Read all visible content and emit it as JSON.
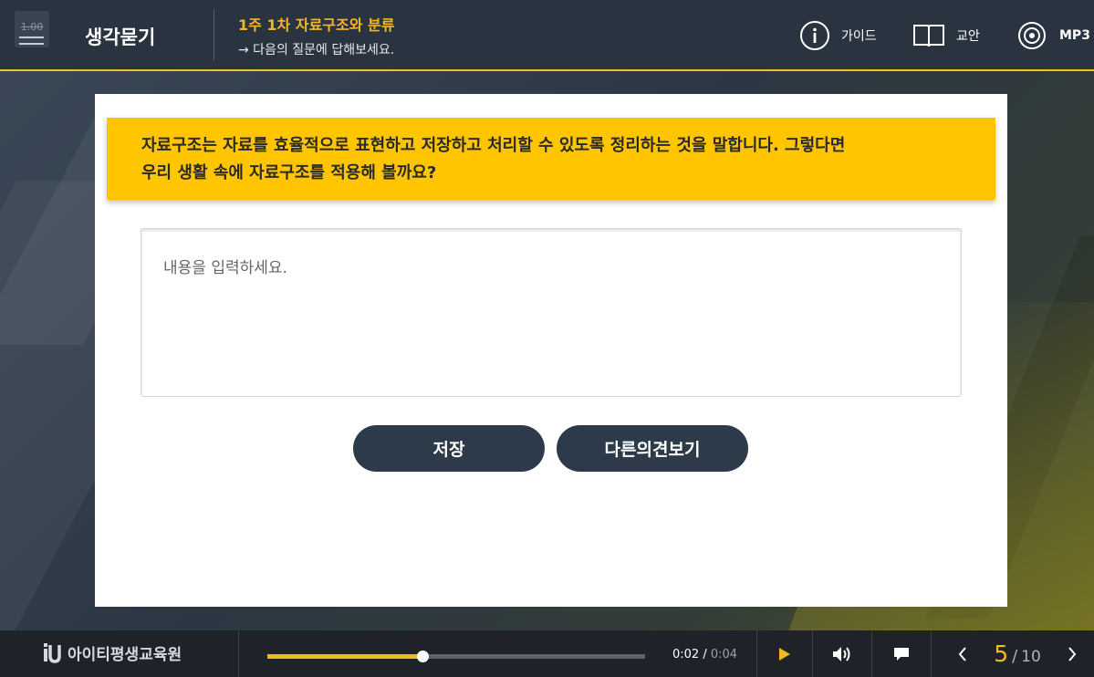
{
  "header": {
    "speed_label": "1.00",
    "section_title": "생각묻기",
    "lesson_title": "1주 1차 자료구조와 분류",
    "lesson_instruction": "→ 다음의 질문에 답해보세요.",
    "tools": {
      "guide": "가이드",
      "plan": "교안",
      "mp3": "MP3"
    }
  },
  "content": {
    "question_line1": "자료구조는 자료를 효율적으로 표현하고 저장하고 처리할 수 있도록 정리하는 것을 말합니다. 그렇다면",
    "question_line2": "우리 생활 속에 자료구조를 적용해 볼까요?",
    "answer_placeholder": "내용을 입력하세요.",
    "answer_value": "",
    "save_label": "저장",
    "others_label": "다른의견보기"
  },
  "footer": {
    "logo_text": "아이티평생교육원",
    "progress": 0.41,
    "time_current": "0:02",
    "time_separator": " / ",
    "time_total": "0:04",
    "page_current": "5",
    "page_separator": "/",
    "page_total": "10"
  },
  "colors": {
    "accent": "#f5b820",
    "question_bg": "#ffc600",
    "button_bg": "#2c3a4a",
    "header_bg": "#2a3340",
    "footer_bg": "#1f2329"
  },
  "icons": {
    "menu": "hamburger-icon",
    "guide": "info-circle-icon",
    "plan": "open-book-icon",
    "mp3": "disc-icon",
    "play": "play-icon",
    "volume": "speaker-icon",
    "caption": "speech-bubble-icon",
    "prev": "chevron-left-icon",
    "next": "chevron-right-icon"
  }
}
